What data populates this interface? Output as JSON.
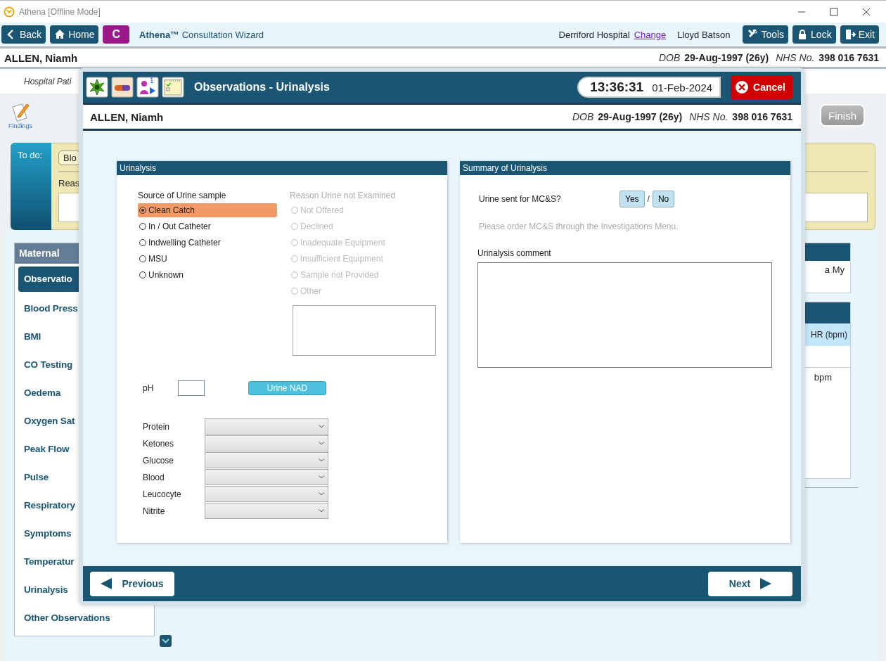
{
  "window": {
    "title": "Athena [Offline Mode]"
  },
  "toolbar": {
    "back": "Back",
    "home": "Home",
    "module": "C",
    "app_title": "**Athena™** Consultation Wizard",
    "hospital": "Derriford Hospital",
    "change_link": "Change",
    "user": "Lloyd Batson",
    "tools": "Tools",
    "lock": "Lock",
    "exit": "Exit"
  },
  "patient_banner": {
    "name": "ALLEN, Niamh",
    "dob_label": "DOB",
    "dob": "29-Aug-1997 (26y)",
    "nhs_label": "NHS No.",
    "nhs": "398 016 7631"
  },
  "context_bar": {
    "text": "Hospital Pati"
  },
  "findings": {
    "label": "Findings"
  },
  "finish_button": {
    "label": "Finish",
    "disabled": true
  },
  "todo": {
    "label": "To do:",
    "chip": "Blo",
    "reason_label": "Reas"
  },
  "sidebar": {
    "header": "Maternal",
    "items": [
      {
        "label": "Observatio",
        "selected": true
      },
      {
        "label": "Blood Press",
        "selected": false
      },
      {
        "label": "BMI",
        "selected": false
      },
      {
        "label": "CO Testing",
        "selected": false
      },
      {
        "label": "Oedema",
        "selected": false
      },
      {
        "label": "Oxygen Sat",
        "selected": false
      },
      {
        "label": "Peak Flow",
        "selected": false
      },
      {
        "label": "Pulse",
        "selected": false
      },
      {
        "label": "Respiratory",
        "selected": false
      },
      {
        "label": "Symptoms",
        "selected": false
      },
      {
        "label": "Temperatur",
        "selected": false
      },
      {
        "label": "Urinalysis",
        "selected": false
      },
      {
        "label": "Other Observations",
        "selected": false
      }
    ]
  },
  "right_panels": {
    "panel_text": "a My",
    "column_header": "HR (bpm)",
    "cell": "bpm"
  },
  "dialog": {
    "icons": [
      {
        "kind": "flower"
      },
      {
        "kind": "pill"
      },
      {
        "kind": "person",
        "badge": "1"
      },
      {
        "kind": "notepad"
      }
    ],
    "title": "Observations - Urinalysis",
    "time": "13:36:31",
    "date": "01-Feb-2024",
    "cancel": "Cancel",
    "patient": {
      "name": "ALLEN, Niamh",
      "dob_label": "DOB",
      "dob": "29-Aug-1997 (26y)",
      "nhs_label": "NHS No.",
      "nhs": "398 016 7631"
    },
    "urinalysis": {
      "title": "Urinalysis",
      "source_label": "Source of Urine sample",
      "source_options": [
        {
          "label": "Clean Catch",
          "selected": true
        },
        {
          "label": "In / Out Catheter",
          "selected": false
        },
        {
          "label": "Indwelling Catheter",
          "selected": false
        },
        {
          "label": "MSU",
          "selected": false
        },
        {
          "label": "Unknown",
          "selected": false
        }
      ],
      "reason_label": "Reason Urine not Examined",
      "reason_disabled": true,
      "reason_options": [
        {
          "label": "Not Offered",
          "selected": false,
          "disabled": true
        },
        {
          "label": "Declined",
          "selected": false,
          "disabled": true
        },
        {
          "label": "Inadequate Equipment",
          "selected": false,
          "disabled": true
        },
        {
          "label": "Insufficient Equipment",
          "selected": false,
          "disabled": true
        },
        {
          "label": "Sample not Provided",
          "selected": false,
          "disabled": true
        },
        {
          "label": "Other",
          "selected": false,
          "disabled": true
        }
      ],
      "ph_label": "pH",
      "nad_button": "Urine NAD",
      "tests": [
        {
          "label": "Protein"
        },
        {
          "label": "Ketones"
        },
        {
          "label": "Glucose"
        },
        {
          "label": "Blood"
        },
        {
          "label": "Leucocyte"
        },
        {
          "label": "Nitrite"
        }
      ]
    },
    "summary": {
      "title": "Summary of Urinalysis",
      "question": "Urine sent for MC&S?",
      "yes": "Yes",
      "separator": "/",
      "no": "No",
      "hint": "Please order MC&S through the Investigations Menu.",
      "comment_label": "Urinalysis comment"
    },
    "previous": "Previous",
    "next": "Next"
  }
}
